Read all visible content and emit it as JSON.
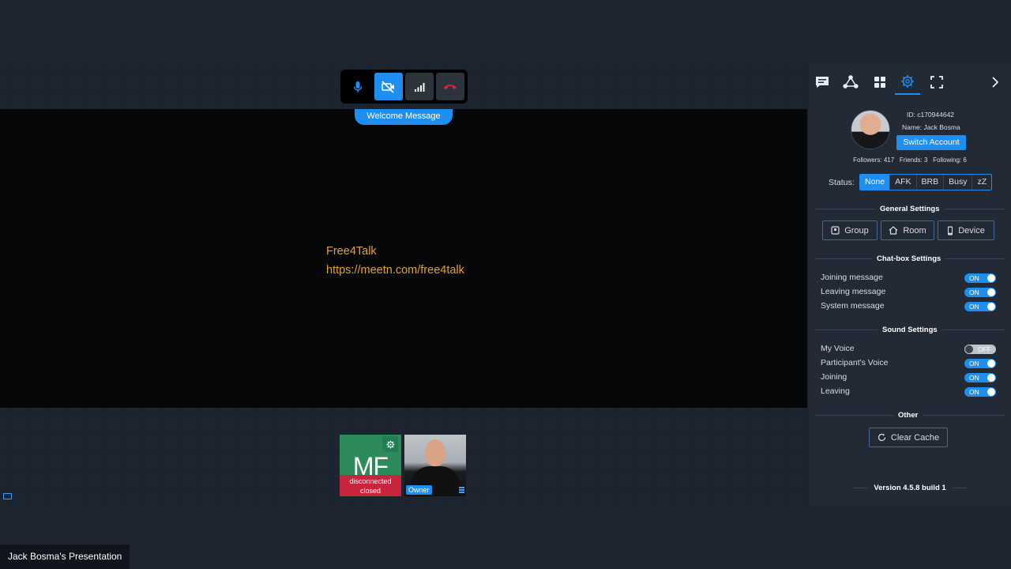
{
  "controls": {
    "mic_icon": "microphone-icon",
    "camera_icon": "camera-off-icon",
    "signal_icon": "signal-bars-icon",
    "hangup_icon": "hang-up-icon"
  },
  "welcome_label": "Welcome Message",
  "message": {
    "line1": "Free4Talk",
    "line2": "https://meetn.com/free4talk",
    "color": "#e0a231"
  },
  "tiles": [
    {
      "initials": "MF",
      "status_line1": "disconnected",
      "status_line2": "closed",
      "bg": "#2c8a5b"
    },
    {
      "badge": "Owner"
    }
  ],
  "sidebar": {
    "tabs": [
      "chat-icon",
      "community-icon",
      "grid-icon",
      "settings-icon",
      "fullscreen-icon",
      "collapse-arrow-icon"
    ],
    "active_tab": "settings-icon",
    "profile": {
      "id_text": "ID: c170944642",
      "name_text": "Name: Jack Bosma",
      "switch_label": "Switch Account",
      "followers": "Followers: 417",
      "friends": "Friends: 3",
      "following": "Following: 6"
    },
    "status": {
      "label": "Status:",
      "options": [
        "None",
        "AFK",
        "BRB",
        "Busy",
        "zZ"
      ],
      "selected": "None"
    },
    "general": {
      "title": "General Settings",
      "buttons": [
        "Group",
        "Room",
        "Device"
      ]
    },
    "chatbox": {
      "title": "Chat-box Settings",
      "items": [
        {
          "label": "Joining message",
          "state": "ON"
        },
        {
          "label": "Leaving message",
          "state": "ON"
        },
        {
          "label": "System message",
          "state": "ON"
        }
      ]
    },
    "sound": {
      "title": "Sound Settings",
      "items": [
        {
          "label": "My Voice",
          "state": "OFF"
        },
        {
          "label": "Participant's Voice",
          "state": "ON"
        },
        {
          "label": "Joining",
          "state": "ON"
        },
        {
          "label": "Leaving",
          "state": "ON"
        }
      ]
    },
    "other": {
      "title": "Other",
      "clear_cache": "Clear Cache"
    },
    "version": "Version 4.5.8 build 1"
  },
  "caption": "Jack Bosma's Presentation",
  "accent": "#1f8ef1"
}
